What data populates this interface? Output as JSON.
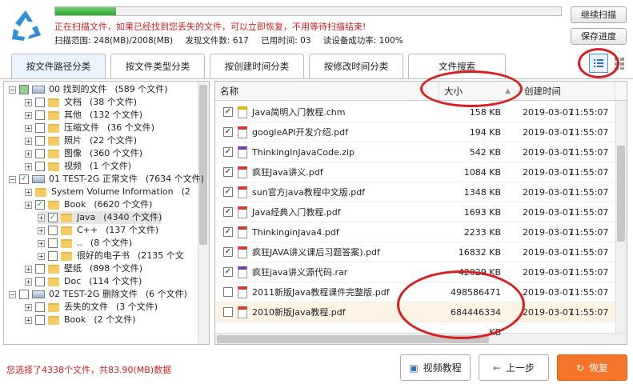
{
  "scan": {
    "progress": 0.12,
    "message": "正在扫描文件，如果已经找到您丢失的文件，可以立即恢复，不用等待扫描结束!",
    "range": "扫描范围: 248(MB)/2008(MB)",
    "found": "发现文件数: 617",
    "elapsed": "已用时间: 03",
    "read_rate": "读设备成功率: 100%"
  },
  "buttons": {
    "continue": "继续扫描",
    "save": "保存进度",
    "video": "视频教程",
    "prev": "上一步",
    "recover": "恢复"
  },
  "tabs": [
    "按文件路径分类",
    "按文件类型分类",
    "按创建时间分类",
    "按修改时间分类",
    "文件搜索"
  ],
  "tree": [
    {
      "label": "00 找到的文件",
      "count": "(589 个文件)",
      "type": "drive"
    },
    {
      "label": "文档",
      "count": "(38 个文件)",
      "type": "folder"
    },
    {
      "label": "其他",
      "count": "(132 个文件)",
      "type": "folder"
    },
    {
      "label": "压缩文件",
      "count": "(36 个文件)",
      "type": "folder"
    },
    {
      "label": "照片",
      "count": "(22 个文件)",
      "type": "folder"
    },
    {
      "label": "图像",
      "count": "(360 个文件)",
      "type": "folder"
    },
    {
      "label": "视频",
      "count": "(1 个文件)",
      "type": "folder"
    },
    {
      "label": "01 TEST-2G 正常文件",
      "count": "(7634 个文件)",
      "type": "drive"
    },
    {
      "label": "System Volume Information",
      "count": "(2",
      "type": "folder"
    },
    {
      "label": "Book",
      "count": "(6620 个文件)",
      "type": "folder"
    },
    {
      "label": "Java",
      "count": "(4340 个文件)",
      "type": "folder"
    },
    {
      "label": "C++",
      "count": "(137 个文件)",
      "type": "folder"
    },
    {
      "label": "..",
      "count": "(8 个文件)",
      "type": "folder"
    },
    {
      "label": "很好的电子书",
      "count": "(2135 个文",
      "type": "folder"
    },
    {
      "label": "壁纸",
      "count": "(898 个文件)",
      "type": "folder"
    },
    {
      "label": "Doc",
      "count": "(114 个文件)",
      "type": "folder"
    },
    {
      "label": "02 TEST-2G 删除文件",
      "count": "(6 个文件)",
      "type": "drive"
    },
    {
      "label": "丢失的文件",
      "count": "(3 个文件)",
      "type": "folder"
    },
    {
      "label": "Book",
      "count": "(2 个文件)",
      "type": "folder"
    }
  ],
  "columns": {
    "name": "名称",
    "size": "大小",
    "time": "创建时间"
  },
  "files": [
    {
      "name": "Java简明入门教程.chm",
      "size": "158 KB",
      "date": "2019-03-07",
      "time": "11:55:07",
      "checked": true,
      "icon": "help-file-icon"
    },
    {
      "name": "googleAPI开发介绍.pdf",
      "size": "194 KB",
      "date": "2019-03-07",
      "time": "11:55:07",
      "checked": true,
      "icon": "pdf-icon"
    },
    {
      "name": "ThinkingInJavaCode.zip",
      "size": "542 KB",
      "date": "2019-03-07",
      "time": "11:55:07",
      "checked": true,
      "icon": "archive-icon"
    },
    {
      "name": "疯狂Java讲义.pdf",
      "size": "1084 KB",
      "date": "2019-03-07",
      "time": "11:55:07",
      "checked": true,
      "icon": "pdf-icon"
    },
    {
      "name": "sun官方java教程中文版.pdf",
      "size": "1348 KB",
      "date": "2019-03-07",
      "time": "11:55:07",
      "checked": true,
      "icon": "pdf-icon"
    },
    {
      "name": "Java经典入门教程.pdf",
      "size": "1693 KB",
      "date": "2019-03-07",
      "time": "11:55:07",
      "checked": true,
      "icon": "pdf-icon"
    },
    {
      "name": "ThinkinginJava4.pdf",
      "size": "2233 KB",
      "date": "2019-03-07",
      "time": "11:55:07",
      "checked": true,
      "icon": "pdf-icon"
    },
    {
      "name": "疯狂JAVA讲义课后习题答案).pdf",
      "size": "16832 KB",
      "date": "2019-03-07",
      "time": "11:55:07",
      "checked": true,
      "icon": "pdf-icon"
    },
    {
      "name": "疯狂java讲义源代码.rar",
      "size": "42029 KB",
      "date": "2019-03-07",
      "time": "11:55:07",
      "checked": true,
      "icon": "archive-icon"
    },
    {
      "name": "2011新版Java教程课件完整版.pdf",
      "size": "498586471 KB",
      "date": "2019-03-07",
      "time": "11:55:07",
      "checked": false,
      "icon": "pdf-icon"
    },
    {
      "name": "2010新版Java教程.pdf",
      "size": "684446334 KB",
      "date": "2019-03-07",
      "time": "11:55:07",
      "checked": false,
      "icon": "pdf-icon"
    }
  ],
  "status": "您选择了4338个文件，共83.90(MB)数据",
  "colors": {
    "accent": "#f5762a",
    "warning": "#d42020",
    "annotation": "#d81f1f",
    "progress": "#2fa52f"
  }
}
